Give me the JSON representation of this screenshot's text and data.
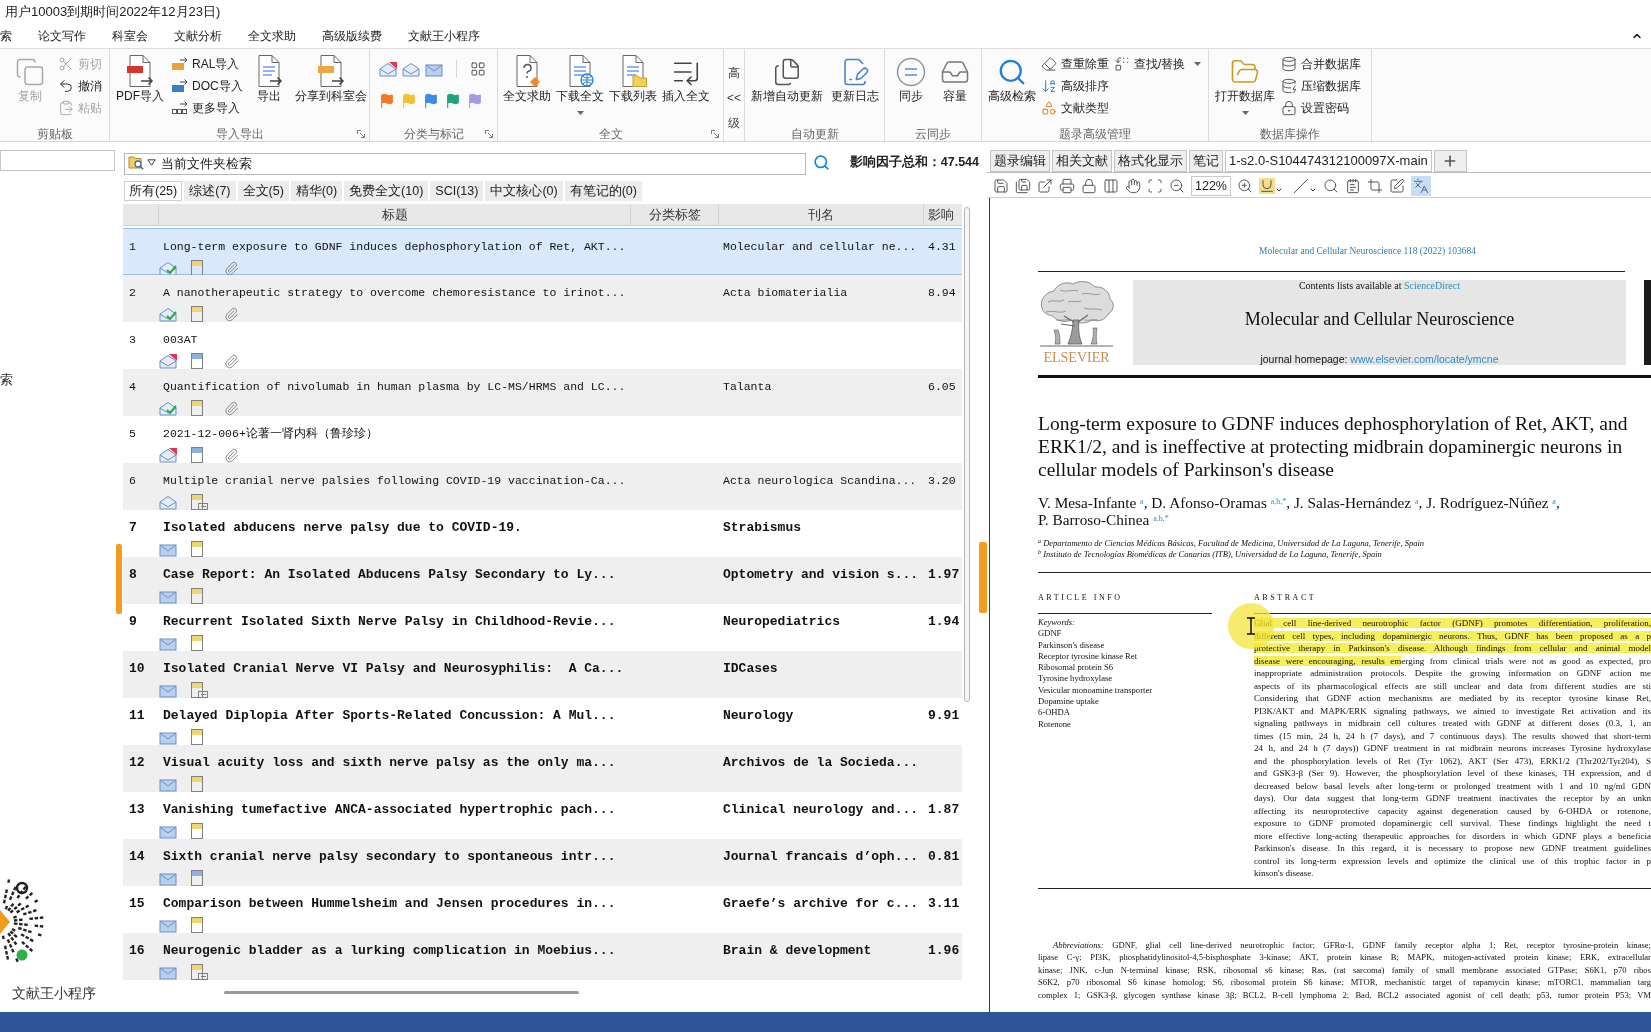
{
  "title_bar": {
    "text": "用户10003到期时间2022年12月23日)"
  },
  "menu": [
    "索",
    "论文写作",
    "科室会",
    "文献分析",
    "全文求助",
    "高级版续费",
    "文献王小程序"
  ],
  "ribbon": [
    {
      "kind": "group",
      "label": "剪贴板",
      "launcher": false,
      "columns": [
        {
          "kind": "large",
          "label": "复制",
          "disabled": true
        },
        {
          "kind": "stack",
          "buttons": [
            {
              "label": "剪切",
              "disabled": true
            },
            {
              "label": "撤消",
              "disabled": false
            },
            {
              "label": "粘贴",
              "disabled": true
            }
          ]
        }
      ]
    },
    {
      "kind": "group",
      "label": "导入导出",
      "launcher": true,
      "columns": [
        {
          "kind": "large",
          "label": "PDF导入"
        },
        {
          "kind": "stack",
          "buttons": [
            {
              "label": "RAL导入"
            },
            {
              "label": "DOC导入"
            },
            {
              "label": "更多导入"
            }
          ]
        },
        {
          "kind": "large",
          "label": "导出"
        },
        {
          "kind": "large",
          "label": "分享到科室会"
        }
      ]
    },
    {
      "kind": "group",
      "label": "分类与标记",
      "launcher": true,
      "columns": [
        {
          "kind": "marks",
          "flags": [
            {
              "color": "#ef7a22"
            },
            {
              "color": "#f2c233"
            },
            {
              "color": "#3a8ee2"
            },
            {
              "color": "#1fa37f"
            },
            {
              "color": "#a89ae2"
            }
          ]
        }
      ]
    },
    {
      "kind": "group",
      "label": "全文",
      "launcher": true,
      "columns": [
        {
          "kind": "large",
          "label": "全文求助",
          "dropdown": false
        },
        {
          "kind": "large",
          "label": "下载全文",
          "dropdown": true
        },
        {
          "kind": "large",
          "label": "下载列表",
          "dropdown": false
        },
        {
          "kind": "large",
          "label": "插入全文",
          "dropdown": false
        }
      ]
    },
    {
      "kind": "collapsed",
      "lines": [
        "高",
        "<<",
        "级"
      ]
    },
    {
      "kind": "group",
      "label": "自动更新",
      "launcher": false,
      "columns": [
        {
          "kind": "large",
          "label": "新增自动更新"
        },
        {
          "kind": "large",
          "label": "更新日志"
        }
      ]
    },
    {
      "kind": "group",
      "label": "云同步",
      "launcher": false,
      "columns": [
        {
          "kind": "large",
          "label": "同步"
        },
        {
          "kind": "large",
          "label": "容量"
        }
      ]
    },
    {
      "kind": "group",
      "label": "题录高级管理",
      "launcher": false,
      "columns": [
        {
          "kind": "large",
          "label": "高级检索"
        },
        {
          "kind": "stack",
          "buttons": [
            {
              "label": "查重除重",
              "dropdown": false
            },
            {
              "label": "高级排序",
              "dropdown": false
            },
            {
              "label": "文献类型",
              "dropdown": false
            }
          ]
        },
        {
          "kind": "stack",
          "buttons": [
            {
              "label": "查找/替换",
              "dropdown": true
            }
          ]
        }
      ]
    },
    {
      "kind": "group",
      "label": "数据库操作",
      "launcher": false,
      "columns": [
        {
          "kind": "large",
          "label": "打开数据库",
          "dropdown": true
        },
        {
          "kind": "stack",
          "buttons": [
            {
              "label": "合并数据库"
            },
            {
              "label": "压缩数据库"
            },
            {
              "label": "设置密码"
            }
          ]
        }
      ]
    }
  ],
  "sidebar": {
    "items": [
      "索"
    ],
    "promo_caption": "文献王小程序"
  },
  "search": {
    "placeholder": "当前文件夹检索",
    "impact_total": "影响因子总和：47.544"
  },
  "filters": [
    {
      "label": "所有(25)",
      "selected": true
    },
    {
      "label": "综述(7)",
      "selected": false
    },
    {
      "label": "全文(5)",
      "selected": false
    },
    {
      "label": "精华(0)",
      "selected": false
    },
    {
      "label": "免费全文(10)",
      "selected": false
    },
    {
      "label": "SCI(13)",
      "selected": false
    },
    {
      "label": "中文核心(0)",
      "selected": false
    },
    {
      "label": "有笔记的(0)",
      "selected": false
    }
  ],
  "table": {
    "columns": [
      "标题",
      "分类标签",
      "刊名",
      "影响"
    ],
    "rows": [
      {
        "number": "1",
        "title": "Long-term exposure to GDNF induces dephosphorylation of Ret, AKT...",
        "journal": "Molecular and cellular ne...",
        "impact": "4.31",
        "selected": true,
        "unread": false,
        "mail": {
          "kind": "open-check"
        },
        "note": {
          "color": "#f3d56e",
          "linked": false
        },
        "attachment": true
      },
      {
        "number": "2",
        "title": "A nanotherapeutic strategy to overcome chemoresistance to irinot...",
        "journal": "Acta biomaterialia",
        "impact": "8.94",
        "selected": false,
        "unread": false,
        "mail": {
          "kind": "open-check"
        },
        "note": {
          "color": "#f3d56e",
          "linked": false
        },
        "attachment": true
      },
      {
        "number": "3",
        "title": "003AT",
        "selected": false,
        "unread": false,
        "mail": {
          "kind": "open-alert"
        },
        "note": {
          "color": "#8eb2df",
          "linked": false
        },
        "attachment": true
      },
      {
        "number": "4",
        "title": "Quantification of nivolumab in human plasma by LC-MS/HRMS and LC...",
        "journal": "Talanta",
        "impact": "6.05",
        "selected": false,
        "unread": false,
        "mail": {
          "kind": "open-check"
        },
        "note": {
          "color": "#f3d56e",
          "linked": false
        },
        "attachment": true
      },
      {
        "number": "5",
        "title": "2021-12-006+论著一肾内科（鲁珍珍）",
        "selected": false,
        "unread": false,
        "mail": {
          "kind": "open-alert"
        },
        "note": {
          "color": "#8eb2df",
          "linked": false
        },
        "attachment": true
      },
      {
        "number": "6",
        "title": "Multiple cranial nerve palsies following COVID-19 vaccination-Ca...",
        "journal": "Acta neurologica Scandina...",
        "impact": "3.20",
        "selected": false,
        "unread": false,
        "mail": {
          "kind": "open"
        },
        "note": {
          "color": "#f3d56e",
          "linked": true
        },
        "attachment": false
      },
      {
        "number": "7",
        "title": "Isolated abducens nerve palsy due to COVID-19.",
        "journal": "Strabismus",
        "selected": false,
        "unread": true,
        "mail": {
          "kind": "closed"
        },
        "note": {
          "color": "#f3d56e",
          "linked": false
        },
        "attachment": false
      },
      {
        "number": "8",
        "title": "Case Report: An Isolated Abducens Palsy Secondary to Ly...",
        "journal": "Optometry and vision s...",
        "impact": "1.97",
        "selected": false,
        "unread": true,
        "mail": {
          "kind": "closed"
        },
        "note": {
          "color": "#f3d56e",
          "linked": false
        },
        "attachment": false
      },
      {
        "number": "9",
        "title": "Recurrent Isolated Sixth Nerve Palsy in Childhood-Revie...",
        "journal": "Neuropediatrics",
        "impact": "1.94",
        "selected": false,
        "unread": true,
        "mail": {
          "kind": "closed"
        },
        "note": {
          "color": "#f3d56e",
          "linked": false
        },
        "attachment": false
      },
      {
        "number": "10",
        "title": "Isolated Cranial Nerve VI Palsy and Neurosyphilis:  A Ca...",
        "journal": "IDCases",
        "selected": false,
        "unread": true,
        "mail": {
          "kind": "closed"
        },
        "note": {
          "color": "#f3d56e",
          "linked": true
        },
        "attachment": false
      },
      {
        "number": "11",
        "title": "Delayed Diplopia After Sports-Related Concussion: A Mul...",
        "journal": "Neurology",
        "impact": "9.91",
        "selected": false,
        "unread": true,
        "mail": {
          "kind": "closed"
        },
        "note": {
          "color": "#f3d56e",
          "linked": false
        },
        "attachment": false
      },
      {
        "number": "12",
        "title": "Visual acuity loss and sixth nerve palsy as the only ma...",
        "journal": "Archivos de la Socieda...",
        "selected": false,
        "unread": true,
        "mail": {
          "kind": "closed"
        },
        "note": {
          "color": "#f3d56e",
          "linked": false
        },
        "attachment": false
      },
      {
        "number": "13",
        "title": "Vanishing tumefactive ANCA-associated hypertrophic pach...",
        "journal": "Clinical neurology and...",
        "impact": "1.87",
        "selected": false,
        "unread": true,
        "mail": {
          "kind": "closed"
        },
        "note": {
          "color": "#f3d56e",
          "linked": false
        },
        "attachment": false
      },
      {
        "number": "14",
        "title": "Sixth cranial nerve palsy secondary to spontaneous intr...",
        "journal": "Journal francais d’oph...",
        "impact": "0.81",
        "selected": false,
        "unread": true,
        "mail": {
          "kind": "closed"
        },
        "note": {
          "color": "#8eb2df",
          "linked": false
        },
        "attachment": false
      },
      {
        "number": "15",
        "title": "Comparison between Hummelsheim and Jensen procedures in...",
        "journal": "Graefe’s archive for c...",
        "impact": "3.11",
        "selected": false,
        "unread": true,
        "mail": {
          "kind": "closed"
        },
        "note": {
          "color": "#f3d56e",
          "linked": false
        },
        "attachment": false
      },
      {
        "number": "16",
        "title": "Neurogenic bladder as a lurking complication in Moebius...",
        "journal": "Brain & development",
        "impact": "1.96",
        "selected": false,
        "unread": true,
        "mail": {
          "kind": "closed"
        },
        "note": {
          "color": "#f3d56e",
          "linked": true
        },
        "attachment": false
      }
    ]
  },
  "viewer": {
    "tabs": [
      {
        "label": "题录编辑",
        "selected": false
      },
      {
        "label": "相关文献",
        "selected": false
      },
      {
        "label": "格式化显示",
        "selected": false
      },
      {
        "label": "笔记",
        "selected": false
      },
      {
        "label": "1-s2.0-S104474312100097X-main",
        "selected": true
      }
    ],
    "zoom": "122%",
    "translate_on": true
  },
  "document": {
    "journal_line": "Molecular and Cellular Neuroscience 118 (2022) 103684",
    "publisher": "ELSEVIER",
    "contents_note": "Contents lists available at",
    "contents_link": "ScienceDirect",
    "journal_title": "Molecular and Cellular Neuroscience",
    "homepage_label": "journal homepage:",
    "homepage_link": "www.elsevier.com/locate/ymcne",
    "title_lines": [
      "Long-term exposure to GDNF induces dephosphorylation of Ret, AKT, and",
      "ERK1/2, and is ineffective at protecting midbrain dopaminergic neurons in",
      "cellular models of Parkinson's disease"
    ],
    "author_lines": [
      "V. Mesa-Infante $^{a}$, D. Afonso-Oramas $^{a,b,*}$, J. Salas-Hernández $^{a}$, J. Rodríguez-Núñez $^{a}$,",
      "P. Barroso-Chinea $^{a,b,*}$"
    ],
    "affiliations": [
      "$^{a}$ Departamento de Ciencias Médicas Básicas, Facultad de Medicina, Universidad de La Laguna, Tenerife, Spain",
      "$^{b}$ Instituto de Tecnologías Biomédicas de Canarias (ITB), Universidad de La Laguna, Tenerife, Spain"
    ],
    "article_info_heading": "ARTICLE INFO",
    "keywords_label": "Keywords:",
    "keywords": [
      "GDNF",
      "Parkinson's disease",
      "Receptor tyrosine kinase Ret",
      "Ribosomal protein S6",
      "Tyrosine hydroxylase",
      "Vesicular monoamine transporter",
      "Dopamine uptake",
      "6-OHDA",
      "Rotenone"
    ],
    "abstract_heading": "ABSTRACT",
    "abstract_lines": [
      {
        "marked": "Glial cell line-derived neurotrophic factor (GDNF) promotes differentiation, proliferation,"
      },
      {
        "marked": "different cell types, including dopaminergic neurons. Thus, GDNF has been proposed as a p"
      },
      {
        "marked": "protective therapy in Parkinson's disease. Although findings from cellular and animal model"
      },
      {
        "marked": "disease were encouraging, results em",
        "text": "erging from clinical trials were not as good as expected, pro"
      },
      {
        "text": "inappropriate administration protocols. Despite the growing information on GDNF action me"
      },
      {
        "text": "aspects of its pharmacological effects are still unclear and data from different studies are sti"
      },
      {
        "text": "Considering that GDNF action mechanisms are mediated by its receptor tyrosine kinase Ret,"
      },
      {
        "text": "PI3K/AKT and MAPK/ERK signaling pathways, we aimed to investigate Ret activation and its"
      },
      {
        "text": "signaling pathways in midbrain cell cultures treated with GDNF at different doses (0.3, 1, an"
      },
      {
        "text": "times (15 min, 24 h, 24 h (7 days), and 7 continuous days). The results showed that short-term"
      },
      {
        "text": "24 h, and 24 h (7 days)) GDNF treatment in rat midbrain neurons increases Tyrosine hydroxylase"
      },
      {
        "text": "and the phosphorylation levels of Ret (Tyr 1062), AKT (Ser 473), ERK1/2 (Thr202/Tyr204), S"
      },
      {
        "text": "and GSK3-β (Ser 9). However, the phosphorylation level of these kinases, TH expression, and d"
      },
      {
        "text": "decreased below basal levels after long-term or prolonged treatment with 1 and 10 ng/ml GDN"
      },
      {
        "text": "days). Our data suggest that long-term GDNF treatment inactivates the receptor by an unkn"
      },
      {
        "text": "affecting its neuroprotective capacity against degeneration caused by 6-OHDA or rotenone,"
      },
      {
        "text": "exposure to GDNF promoted dopaminergic cell survival. These findings highlight the need t"
      },
      {
        "text": "more effective long-acting therapeutic approaches for disorders in which GDNF plays a beneficia"
      },
      {
        "text": "Parkinson's disease. In this regard, it is necessary to propose new GDNF treatment guidelines"
      },
      {
        "text": "control its long-term expression levels and optimize the clinical use of this trophic factor in p"
      },
      {
        "text": "kinson's disease."
      }
    ],
    "abbreviation_lines": [
      "*Abbreviations:* GDNF, glial cell line-derived neurotrophic factor; GFRα-1, GDNF family receptor alpha 1; Ret, receptor tyrosine-protein kinase;",
      "lipase C-γ; PI3K, phosphatidylinositol-4,5-bisphosphate 3-kinase; AKT, protein kinase B; MAPK, mitogen-activated protein kinase; ERK, extracellular",
      "kinase; JNK, c-Jun N-terminal kinase; RSK, ribosomal s6 kinase; Ras, (rat sarcoma) family of small membrane associated GTPase; S6K1, p70 ribos",
      "S6K2, p70 ribosomal S6 kinase homolog; S6, ribosomal protein S6 kinase; MTOR, mechanistic target of rapamycin kinase; mTORC1, mammalian targ",
      "complex 1; GSK3-β, glycogen synthase kinase 3β; BCL2, B-cell lymphoma 2; Bad, BCL2 associated agonist of cell death; p53, tumor protein P53; VM"
    ]
  }
}
